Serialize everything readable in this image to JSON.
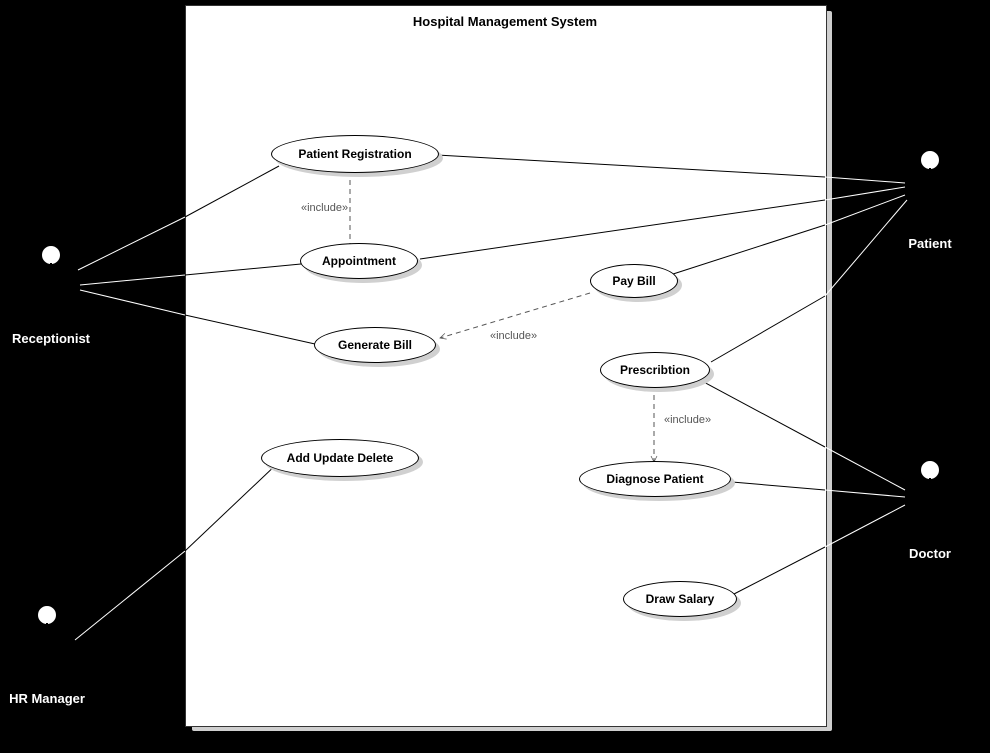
{
  "system": {
    "title": "Hospital Management System"
  },
  "usecases": {
    "patient_registration": "Patient Registration",
    "appointment": "Appointment",
    "pay_bill": "Pay Bill",
    "generate_bill": "Generate Bill",
    "prescription": "Prescribtion",
    "add_update_delete": "Add Update Delete",
    "diagnose_patient": "Diagnose Patient",
    "draw_salary": "Draw Salary"
  },
  "actors": {
    "receptionist": "Receptionist",
    "hr_manager": "HR Manager",
    "patient": "Patient",
    "doctor": "Doctor"
  },
  "relations": {
    "include_label": "«include»"
  }
}
